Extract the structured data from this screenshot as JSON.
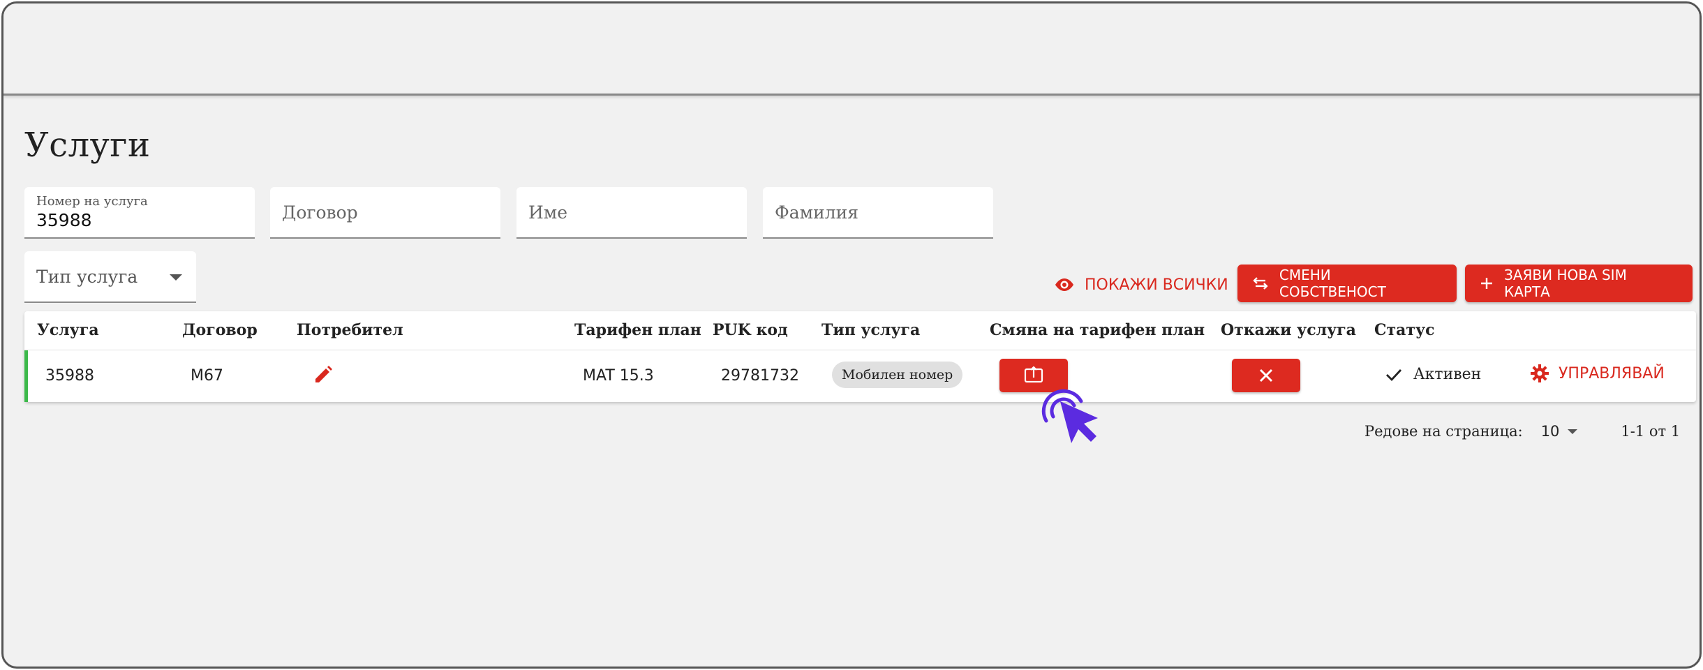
{
  "page": {
    "title": "Услуги"
  },
  "filters": {
    "service_number": {
      "label": "Номер на услуга",
      "value": "35988"
    },
    "contract": {
      "placeholder": "Договор"
    },
    "first_name": {
      "placeholder": "Име"
    },
    "last_name": {
      "placeholder": "Фамилия"
    },
    "service_type": {
      "placeholder": "Тип услуга"
    }
  },
  "actions": {
    "show_all": "ПОКАЖИ ВСИЧКИ",
    "change_ownership": "СМЕНИ СОБСТВЕНОСТ",
    "request_sim": "ЗАЯВИ НОВА SIM КАРТА"
  },
  "table": {
    "headers": [
      "Услуга",
      "Договор",
      "Потребител",
      "Тарифен план",
      "PUK код",
      "Тип услуга",
      "Смяна на тарифен план",
      "Откажи услуга",
      "Статус"
    ],
    "rows": [
      {
        "service": "35988",
        "contract": "M67",
        "tariff": "MAT 15.3",
        "puk": "29781732",
        "type": "Мобилен номер",
        "status": "Активен",
        "manage": "УПРАВЛЯВАЙ"
      }
    ]
  },
  "pagination": {
    "rows_label": "Редове на страница:",
    "rows_per_page": "10",
    "range": "1-1 от 1"
  },
  "colors": {
    "accent": "#dd2a20",
    "active_row": "#3cb94a",
    "cursor": "#5b2be0"
  },
  "icons": [
    "eye-icon",
    "swap-icon",
    "plus-icon",
    "pencil-icon",
    "tariff-change-icon",
    "close-icon",
    "check-icon",
    "gear-icon",
    "dropdown-caret-icon",
    "cursor-click-icon"
  ]
}
